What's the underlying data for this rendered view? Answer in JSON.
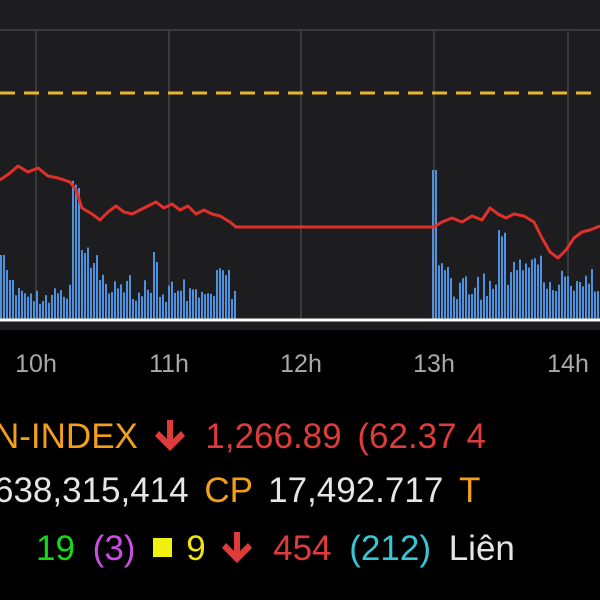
{
  "colors": {
    "price_line": "#e0302a",
    "reference_line": "#e8b52e",
    "volume_bars": "#4d92e0",
    "grid": "#3a3a3c",
    "index_name": "#f2a01b",
    "down": "#e03b3b",
    "up": "#16d816",
    "ceiling": "#c84fe0",
    "unchanged": "#f2e30f",
    "floor": "#38c6d6"
  },
  "chart": {
    "x_ticks": [
      "10h",
      "11h",
      "12h",
      "13h",
      "14h"
    ]
  },
  "index": {
    "name": "N-INDEX",
    "direction_icon": "arrow-down-icon",
    "value": "1,266.89",
    "change": "(62.37 4"
  },
  "volume": {
    "shares": "638,315,414",
    "cp_label": "CP",
    "value": "17,492.717",
    "trailing": "T"
  },
  "breadth": {
    "advancers": "19",
    "ceiling": "(3)",
    "unchanged_icon": "square-icon",
    "unchanged": "9",
    "decliners_icon": "arrow-down-icon",
    "decliners": "454",
    "floor": "(212)",
    "trailing": "Liên"
  }
}
